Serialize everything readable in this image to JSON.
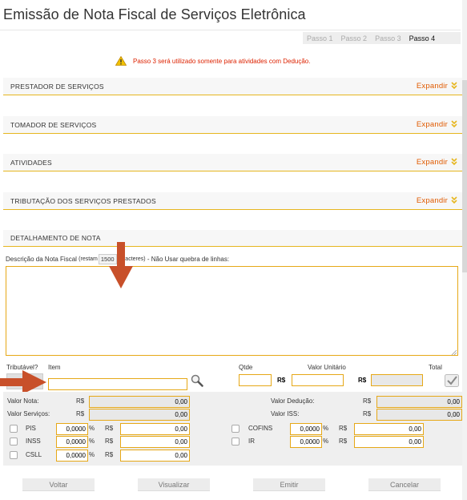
{
  "header": {
    "title": "Emissão de Nota Fiscal de Serviços Eletrônica"
  },
  "steps": [
    "Passo 1",
    "Passo 2",
    "Passo 3",
    "Passo 4"
  ],
  "active_step": "Passo 4",
  "warning": {
    "icon": "warning-icon",
    "text": "Passo 3 será utilizado somente para atividades com Dedução."
  },
  "sections": [
    {
      "title": "PRESTADOR DE SERVIÇOS",
      "action": "Expandir"
    },
    {
      "title": "TOMADOR DE SERVIÇOS",
      "action": "Expandir"
    },
    {
      "title": "ATIVIDADES",
      "action": "Expandir"
    },
    {
      "title": "TRIBUTAÇÃO DOS SERVIÇOS PRESTADOS",
      "action": "Expandir"
    }
  ],
  "detail": {
    "title": "DETALHAMENTO DE NOTA",
    "desc_label_a": "Descrição da Nota Fiscal",
    "desc_restam": "(restam",
    "desc_counter": "1500",
    "desc_caracteres": "caracteres)",
    "desc_label_b": "- Não Usar quebra de linhas:",
    "desc_value": ""
  },
  "items": {
    "tributavel_label": "Tributável?",
    "item_label": "Item",
    "qtde_label": "Qtde",
    "valor_unitario_label": "Valor Unitário",
    "total_label": "Total",
    "currency": "R$",
    "item_value": "",
    "qtde_value": "",
    "valor_unitario_value": "",
    "total_value": ""
  },
  "totals": {
    "valor_nota_label": "Valor Nota:",
    "valor_nota": "0,00",
    "valor_servicos_label": "Valor Serviços:",
    "valor_servicos": "0,00",
    "valor_deducao_label": "Valor Dedução:",
    "valor_deducao": "0,00",
    "valor_iss_label": "Valor ISS:",
    "valor_iss": "0,00",
    "currency": "R$"
  },
  "taxes": {
    "pct_sign": "%",
    "currency": "R$",
    "pis_label": "PIS",
    "pis_rate": "0,0000",
    "pis_value": "0,00",
    "inss_label": "INSS",
    "inss_rate": "0,0000",
    "inss_value": "0,00",
    "csll_label": "CSLL",
    "csll_rate": "0,0000",
    "csll_value": "0,00",
    "cofins_label": "COFINS",
    "cofins_rate": "0,0000",
    "cofins_value": "0,00",
    "ir_label": "IR",
    "ir_rate": "0,0000",
    "ir_value": "0,00"
  },
  "buttons": {
    "voltar": "Voltar",
    "visualizar": "Visualizar",
    "emitir": "Emitir",
    "cancelar": "Cancelar"
  },
  "colors": {
    "accent": "#e6a817",
    "expand_text": "#e05a00",
    "warning_text": "#dd2200",
    "arrow": "#c8502a"
  }
}
